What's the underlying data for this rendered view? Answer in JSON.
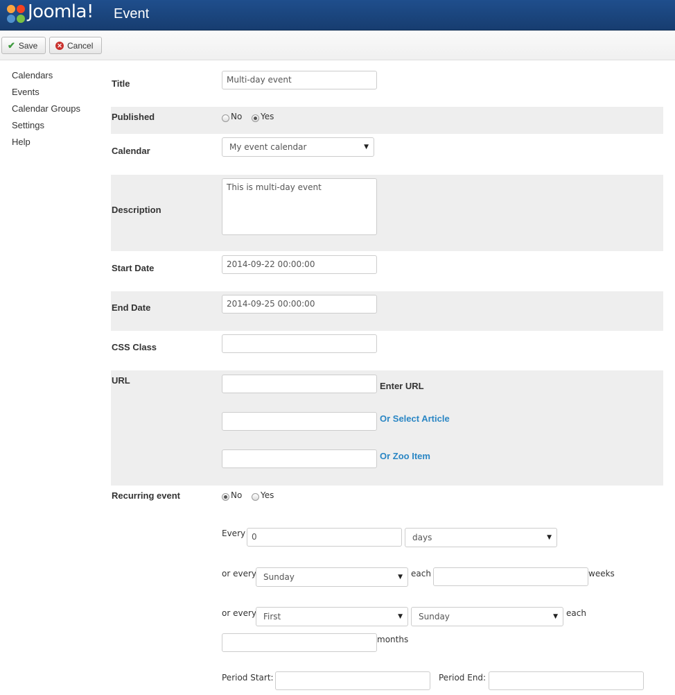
{
  "header": {
    "brand": "Joomla!",
    "title": "Event"
  },
  "toolbar": {
    "save_label": "Save",
    "cancel_label": "Cancel"
  },
  "sidebar": {
    "items": [
      {
        "label": "Calendars"
      },
      {
        "label": "Events"
      },
      {
        "label": "Calendar Groups"
      },
      {
        "label": "Settings"
      },
      {
        "label": "Help"
      }
    ]
  },
  "form": {
    "title": {
      "label": "Title",
      "value": "Multi-day event"
    },
    "published": {
      "label": "Published",
      "options": [
        "No",
        "Yes"
      ],
      "selected": "Yes"
    },
    "calendar": {
      "label": "Calendar",
      "value": "My event calendar"
    },
    "description": {
      "label": "Description",
      "value": "This is multi-day event"
    },
    "start_date": {
      "label": "Start Date",
      "value": "2014-09-22 00:00:00"
    },
    "end_date": {
      "label": "End Date",
      "value": "2014-09-25 00:00:00"
    },
    "css_class": {
      "label": "CSS Class",
      "value": ""
    },
    "url": {
      "label": "URL",
      "enter_url": "Enter URL",
      "select_article": "Or Select Article",
      "zoo_item": "Or Zoo Item"
    },
    "recurring": {
      "label": "Recurring event",
      "options": [
        "No",
        "Yes"
      ],
      "selected": "No",
      "every_label": "Every",
      "every_value": "0",
      "every_unit": "days",
      "or_every_label": "or every",
      "weekday_value": "Sunday",
      "each_label": "each",
      "weeks_label": "weeks",
      "ordinal_value": "First",
      "month_weekday_value": "Sunday",
      "months_label": "months",
      "period_start_label": "Period Start:",
      "period_end_label": "Period End:"
    }
  }
}
